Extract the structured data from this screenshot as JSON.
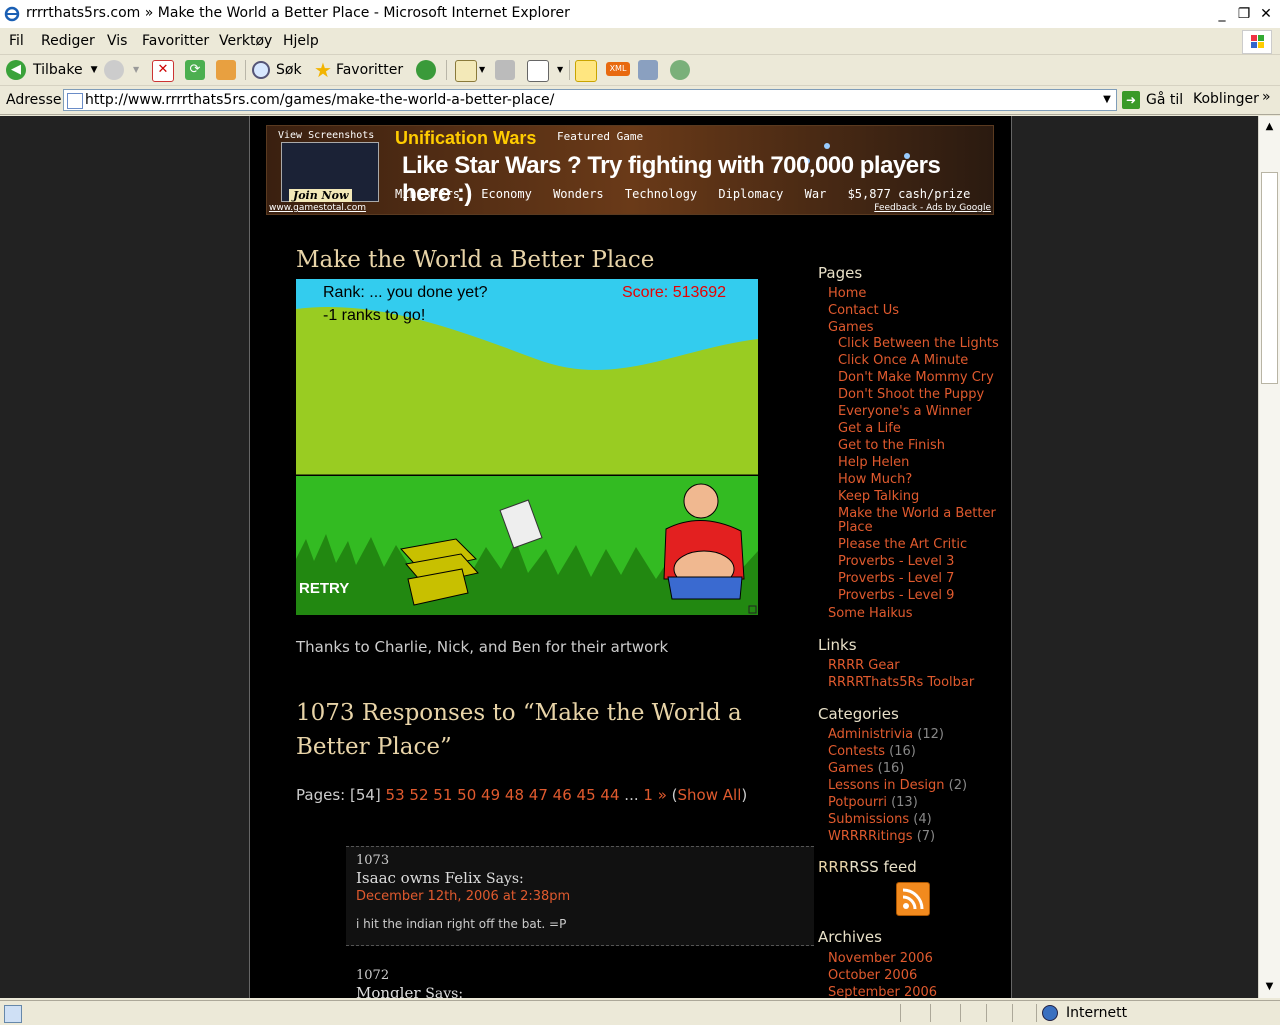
{
  "window": {
    "title": "rrrrthats5rs.com » Make the World a Better Place - Microsoft Internet Explorer",
    "minimize": "_",
    "maximize": "❐",
    "close": "✕"
  },
  "menu": [
    "Fil",
    "Rediger",
    "Vis",
    "Favoritter",
    "Verktøy",
    "Hjelp"
  ],
  "toolbar": {
    "back_label": "Tilbake",
    "search_label": "Søk",
    "favorites_label": "Favoritter"
  },
  "address": {
    "label": "Adresse",
    "url": "http://www.rrrrthats5rs.com/games/make-the-world-a-better-place/",
    "go_label": "Gå til",
    "links_label": "Koblinger"
  },
  "ad": {
    "screenshots": "View Screenshots",
    "join": "Join Now",
    "brand": "Unification Wars",
    "featured": "Featured Game",
    "headline": "Like Star Wars ? Try fighting with 700,000 players here :)",
    "nav": [
      "Ministers",
      "Economy",
      "Wonders",
      "Technology",
      "Diplomacy",
      "War",
      "$5,877 cash/prize"
    ],
    "site": "www.gamestotal.com",
    "feedback": "Feedback - Ads by Google"
  },
  "post": {
    "title": "Make the World a Better Place",
    "thanks": "Thanks to Charlie, Nick, and Ben for their artwork"
  },
  "game": {
    "rank": "Rank: ... you done yet?",
    "to_go": "-1 ranks to go!",
    "score": "Score: 513692",
    "retry": "RETRY"
  },
  "responses": {
    "title": "1073 Responses to “Make the World a Better Place”",
    "pages_label": "Pages:",
    "current_page": "[54]",
    "page_links": [
      "53",
      "52",
      "51",
      "50",
      "49",
      "48",
      "47",
      "46",
      "45",
      "44"
    ],
    "ellipsis": "...",
    "first": "1 »",
    "show_all": "Show All"
  },
  "comments": [
    {
      "num": "1073",
      "author": "Isaac owns Felix",
      "says": "Says:",
      "date": "December 12th, 2006 at 2:38pm",
      "text": "i hit the indian right off the bat. =P"
    },
    {
      "num": "1072",
      "author": "Mongler",
      "says": "Says:"
    }
  ],
  "sidebar": {
    "pages_title": "Pages",
    "pages": [
      "Home",
      "Contact Us",
      "Games"
    ],
    "games": [
      "Click Between the Lights",
      "Click Once A Minute",
      "Don't Make Mommy Cry",
      "Don't Shoot the Puppy",
      "Everyone's a Winner",
      "Get a Life",
      "Get to the Finish",
      "Help Helen",
      "How Much?",
      "Keep Talking",
      "Make the World a Better Place",
      "Please the Art Critic",
      "Proverbs - Level 3",
      "Proverbs - Level 7",
      "Proverbs - Level 9"
    ],
    "haikus": "Some Haikus",
    "links_title": "Links",
    "links": [
      "RRRR Gear",
      "RRRRThats5Rs Toolbar"
    ],
    "categories_title": "Categories",
    "categories": [
      {
        "name": "Administrivia",
        "count": "(12)"
      },
      {
        "name": "Contests",
        "count": "(16)"
      },
      {
        "name": "Games",
        "count": "(16)"
      },
      {
        "name": "Lessons in Design",
        "count": "(2)"
      },
      {
        "name": "Potpourri",
        "count": "(13)"
      },
      {
        "name": "Submissions",
        "count": "(4)"
      },
      {
        "name": "WRRRRitings",
        "count": "(7)"
      }
    ],
    "rss_prefix": "RRR",
    "rss_title": "RSS feed",
    "archives_title": "Archives",
    "archives": [
      "November 2006",
      "October 2006",
      "September 2006"
    ]
  },
  "status": {
    "zone": "Internett"
  }
}
